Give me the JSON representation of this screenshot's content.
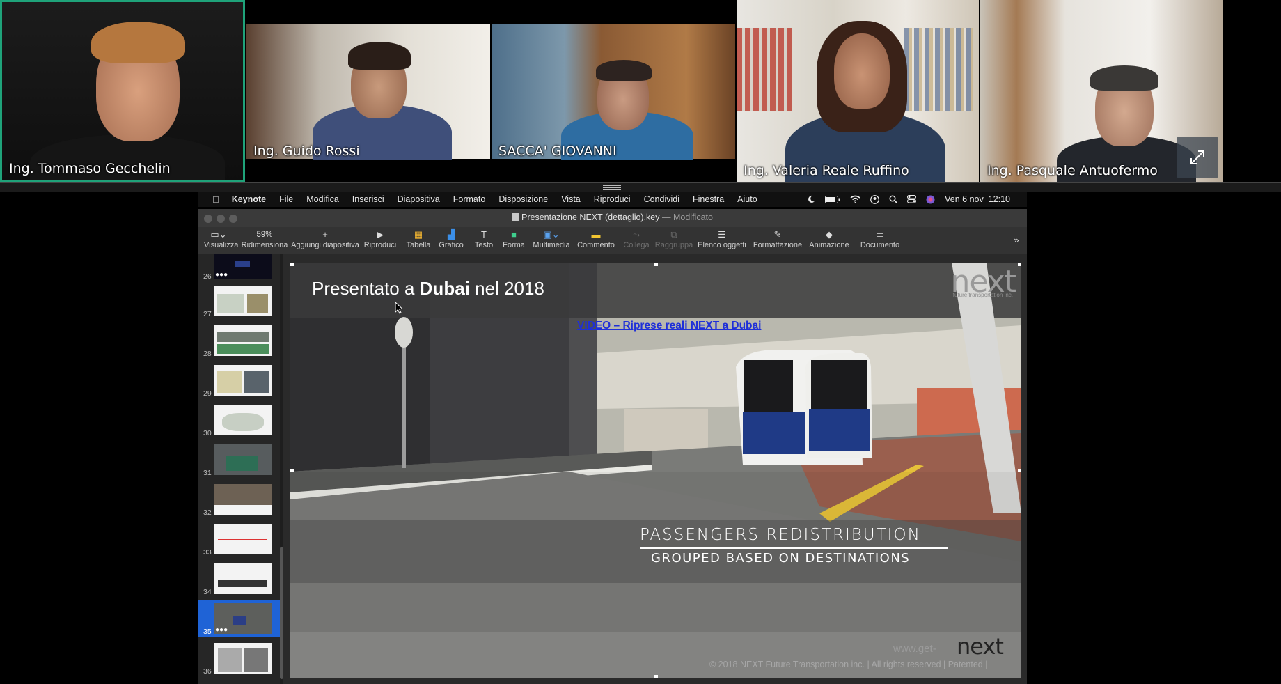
{
  "participants": [
    {
      "name": "Ing. Tommaso Gecchelin",
      "active": true
    },
    {
      "name": "Ing. Guido Rossi",
      "active": false
    },
    {
      "name": "SACCA' GIOVANNI",
      "active": false
    },
    {
      "name": "Ing. Valeria Reale Ruffino",
      "active": false
    },
    {
      "name": "Ing.  Pasquale Antuofermo",
      "active": false
    }
  ],
  "menubar": {
    "app": "Keynote",
    "items": [
      "File",
      "Modifica",
      "Inserisci",
      "Diapositiva",
      "Formato",
      "Disposizione",
      "Vista",
      "Riproduci",
      "Condividi",
      "Finestra",
      "Aiuto"
    ],
    "clock": "Ven 6 nov  12:10"
  },
  "window": {
    "title": "Presentazione NEXT (dettaglio).key",
    "separator": "—",
    "status": "Modificato"
  },
  "toolbar": {
    "zoom": "59%",
    "visualizza": "Visualizza",
    "ridimensiona": "Ridimensiona",
    "aggiungi": "Aggiungi diapositiva",
    "riproduci": "Riproduci",
    "tabella": "Tabella",
    "grafico": "Grafico",
    "testo": "Testo",
    "forma": "Forma",
    "multimedia": "Multimedia",
    "commento": "Commento",
    "collega": "Collega",
    "raggruppa": "Raggruppa",
    "elenco": "Elenco oggetti",
    "formattazione": "Formattazione",
    "animazione": "Animazione",
    "documento": "Documento"
  },
  "navigator": {
    "slides": [
      "26",
      "27",
      "28",
      "29",
      "30",
      "31",
      "32",
      "33",
      "34",
      "35",
      "36"
    ],
    "selected": "35"
  },
  "slide": {
    "title_pre": "Presentato a ",
    "title_bold": "Dubai",
    "title_post": " nel 2018",
    "link": "VIDEO – Riprese reali NEXT a Dubai",
    "caption_main": "PASSENGERS REDISTRIBUTION",
    "caption_sub": "GROUPED BASED ON DESTINATIONS",
    "logo": "next",
    "logo_sub": "future transportation inc.",
    "website": "www.get-",
    "copyright": "© 2018 NEXT Future Transportation inc. | All rights reserved | Patented |"
  },
  "colors": {
    "active_speaker_border": "#1fa37a",
    "selected_slide": "#1f63d6",
    "link": "#1f2fd8"
  }
}
